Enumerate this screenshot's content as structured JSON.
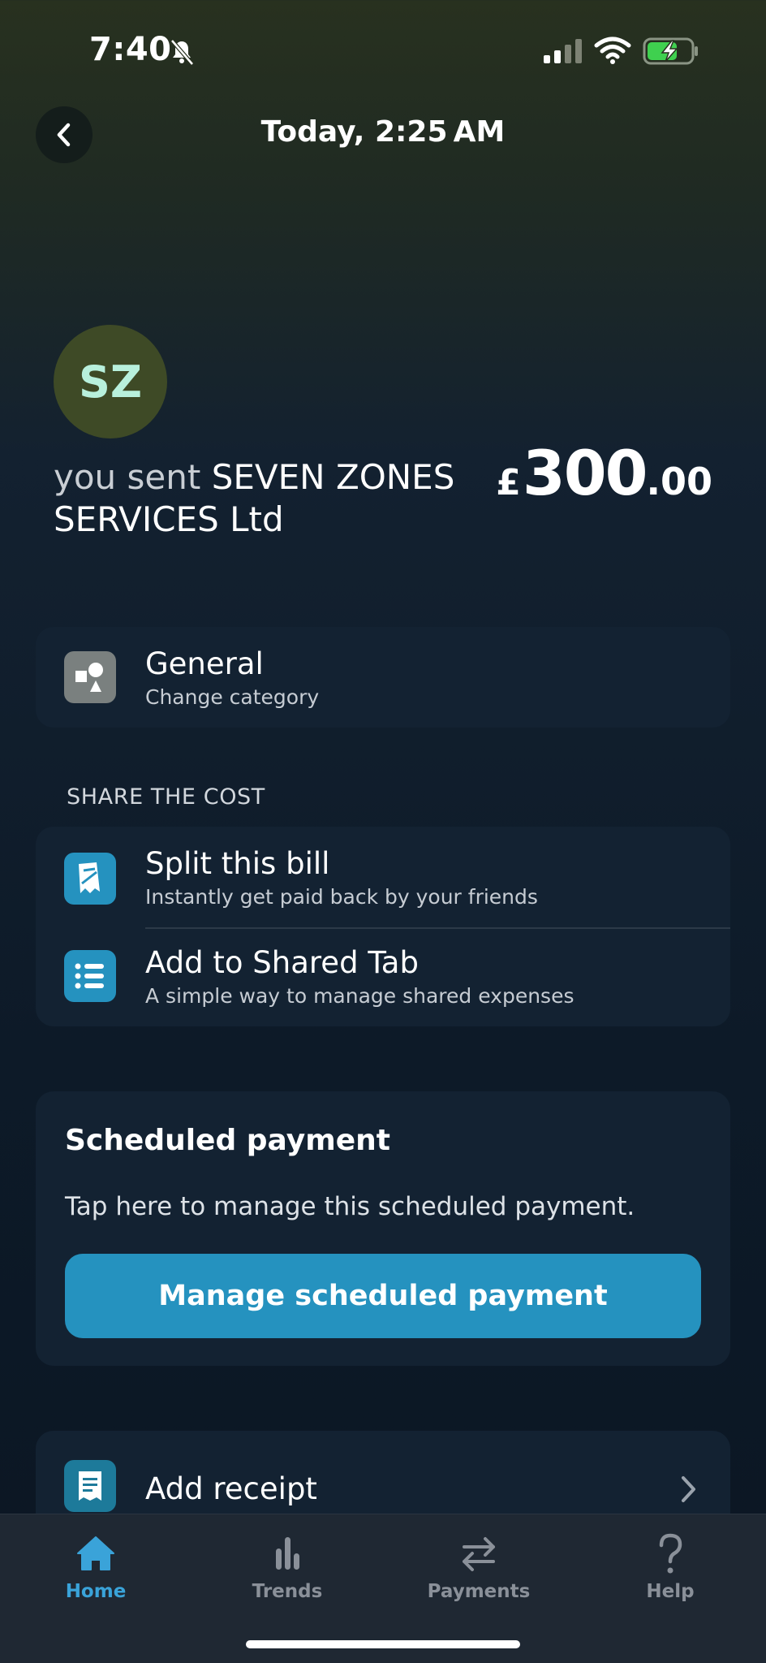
{
  "status_bar": {
    "time": "7:40"
  },
  "header": {
    "title": "Today, 2:25 AM"
  },
  "transaction": {
    "avatar_initials": "SZ",
    "direction_text": "you sent",
    "merchant": "SEVEN ZONES SERVICES Ltd",
    "currency_symbol": "£",
    "amount_major": "300",
    "amount_minor": ".00"
  },
  "category": {
    "title": "General",
    "subtitle": "Change category",
    "icon": "shapes-icon"
  },
  "share_section": {
    "label": "SHARE THE COST",
    "items": [
      {
        "title": "Split this bill",
        "subtitle": "Instantly get paid back by your friends",
        "icon": "split-bill-icon"
      },
      {
        "title": "Add to Shared Tab",
        "subtitle": "A simple way to manage shared expenses",
        "icon": "list-icon"
      }
    ]
  },
  "scheduled": {
    "title": "Scheduled payment",
    "description": "Tap here to manage this scheduled payment.",
    "button_label": "Manage scheduled payment"
  },
  "receipt": {
    "label": "Add receipt",
    "icon": "receipt-icon"
  },
  "tab_bar": {
    "tabs": [
      {
        "label": "Home",
        "icon": "home-icon",
        "active": true
      },
      {
        "label": "Trends",
        "icon": "bar-chart-icon",
        "active": false
      },
      {
        "label": "Payments",
        "icon": "transfer-arrows-icon",
        "active": false
      },
      {
        "label": "Help",
        "icon": "question-mark-icon",
        "active": false
      }
    ]
  },
  "colors": {
    "accent": "#2592bf",
    "tab_active": "#3aa3d9",
    "card_bg": "#132232",
    "avatar_bg": "#3e4a26",
    "avatar_text": "#b8f0dc"
  }
}
